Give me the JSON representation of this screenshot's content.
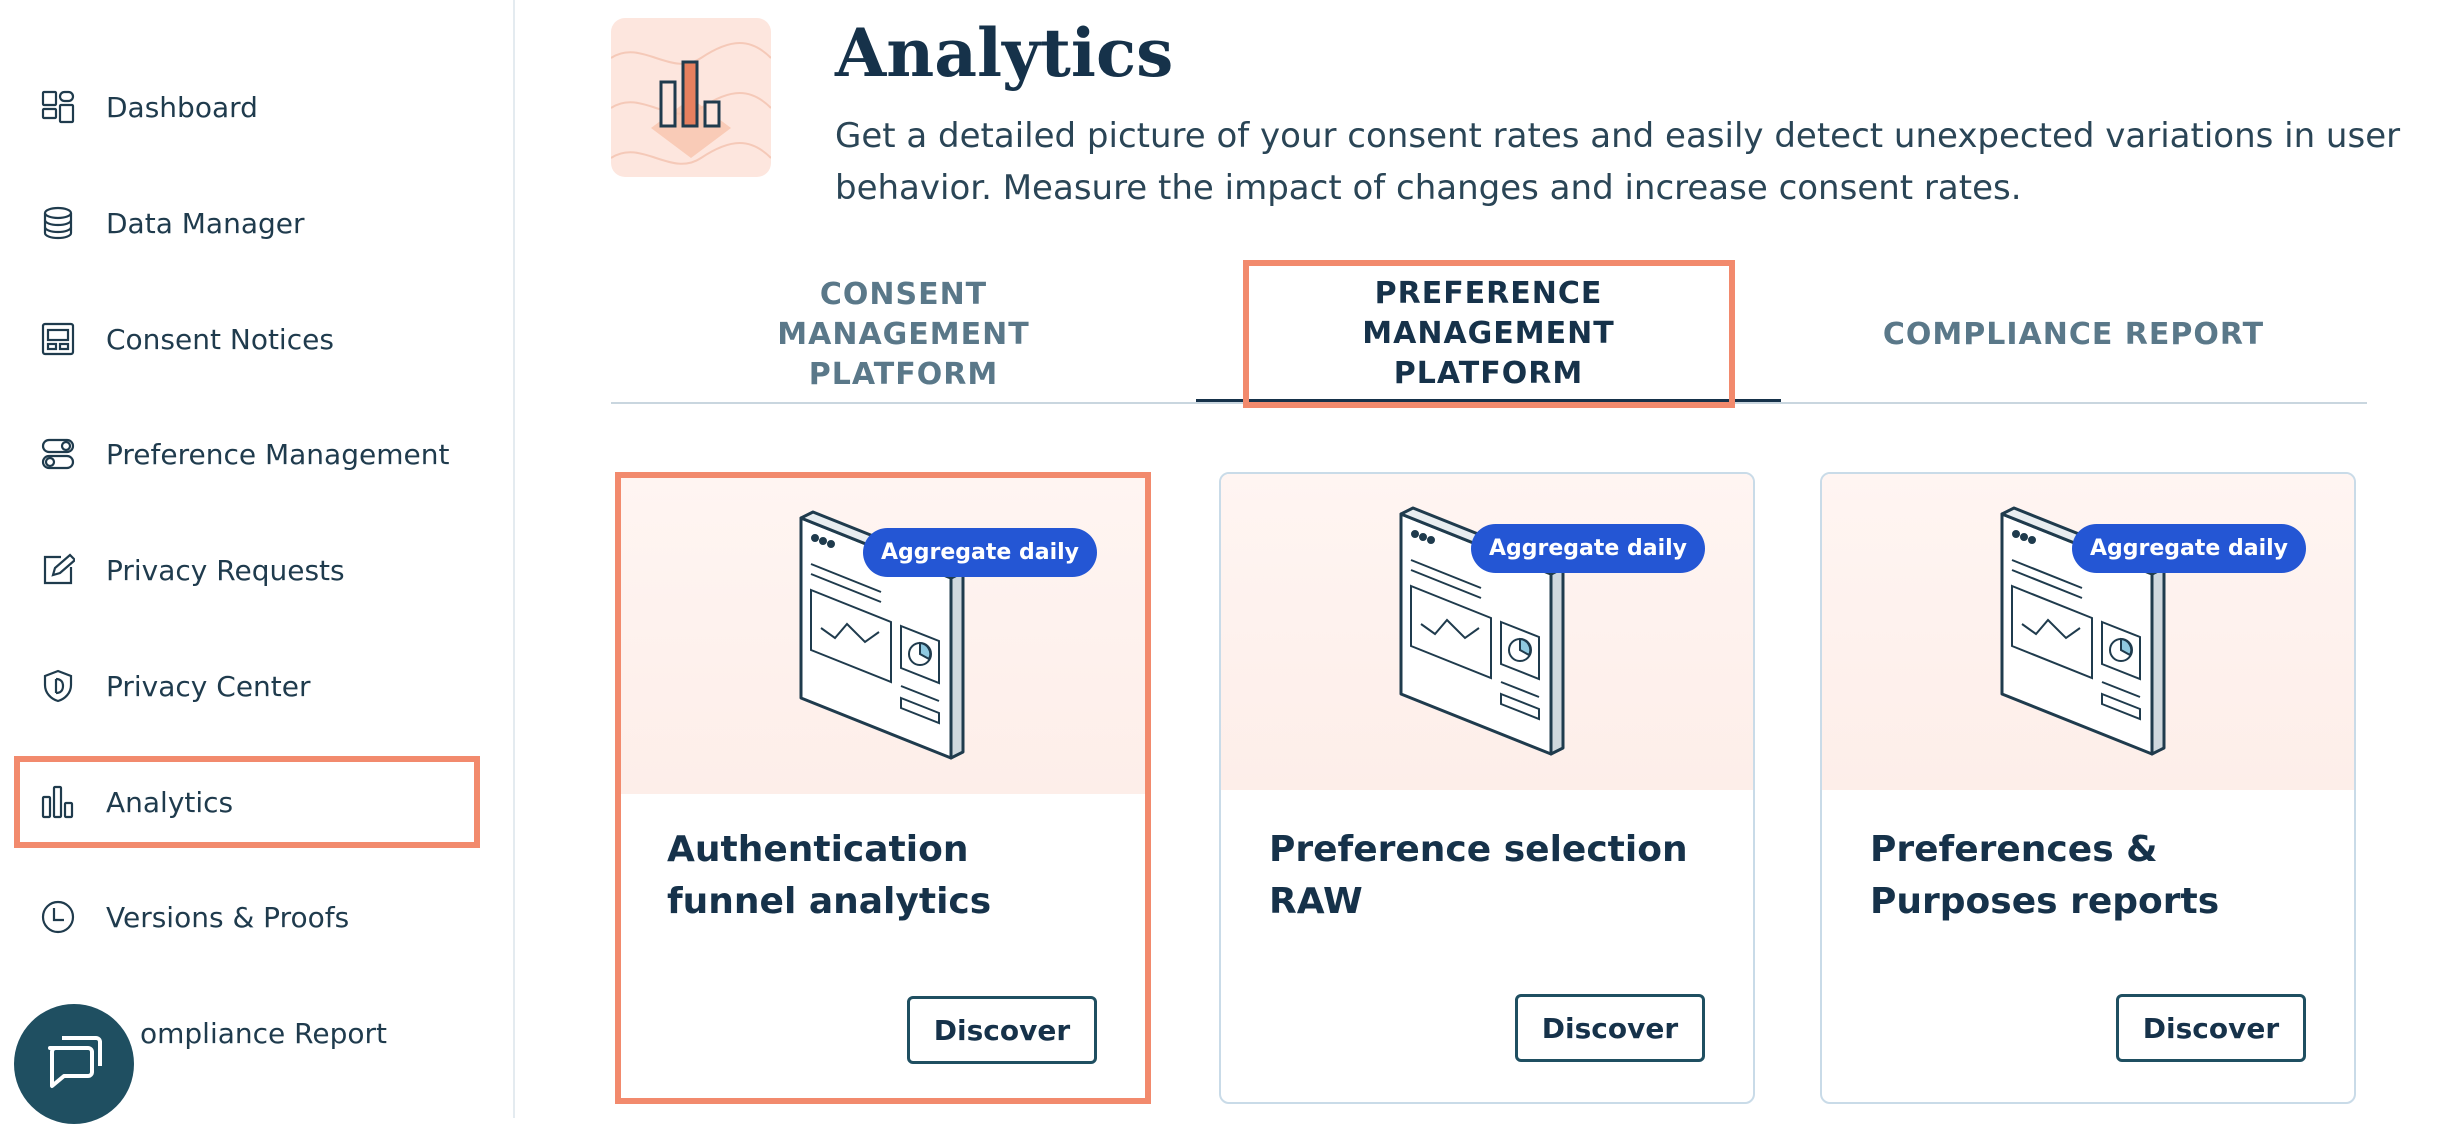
{
  "sidebar": {
    "items": [
      {
        "label": "Dashboard",
        "icon": "dashboard-icon"
      },
      {
        "label": "Data Manager",
        "icon": "database-icon"
      },
      {
        "label": "Consent Notices",
        "icon": "notice-icon"
      },
      {
        "label": "Preference Management",
        "icon": "toggle-icon"
      },
      {
        "label": "Privacy Requests",
        "icon": "edit-icon"
      },
      {
        "label": "Privacy Center",
        "icon": "shield-icon"
      },
      {
        "label": "Analytics",
        "icon": "bar-chart-icon"
      },
      {
        "label": "Versions & Proofs",
        "icon": "clock-icon"
      },
      {
        "label": "ompliance Report",
        "icon": "report-icon"
      }
    ],
    "active": "Analytics"
  },
  "header": {
    "title": "Analytics",
    "subtitle": "Get a detailed picture of your consent rates and easily detect unexpected variations in user behavior. Measure the impact of changes and increase consent rates."
  },
  "tabs": [
    {
      "label": "CONSENT MANAGEMENT PLATFORM"
    },
    {
      "label": "PREFERENCE MANAGEMENT PLATFORM"
    },
    {
      "label": "COMPLIANCE REPORT"
    }
  ],
  "active_tab": "PREFERENCE MANAGEMENT PLATFORM",
  "cards": [
    {
      "badge": "Aggregate daily",
      "title": "Authentication funnel analytics",
      "button": "Discover"
    },
    {
      "badge": "Aggregate daily",
      "title": "Preference selection RAW",
      "button": "Discover"
    },
    {
      "badge": "Aggregate daily",
      "title": "Preferences & Purposes reports",
      "button": "Discover"
    }
  ],
  "colors": {
    "accent_highlight": "#f28a6d",
    "badge": "#2456d4",
    "text_dark": "#16324a",
    "chat_button": "#1f4f61"
  }
}
